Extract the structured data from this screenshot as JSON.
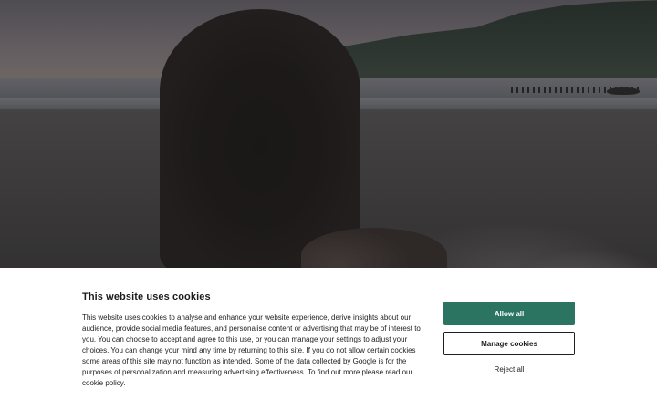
{
  "cookie_banner": {
    "title": "This website uses cookies",
    "body": "This website uses cookies to analyse and enhance your website experience, derive insights about our audience, provide social media features, and personalise content or advertising that may be of interest to you. You can choose to accept and agree to this use, or you can manage your settings to adjust your choices. You can change your mind any time by returning to this site. If you do not allow certain cookies some areas of this site may not function as intended. Some of the data collected by Google is for the purposes of personalization and measuring advertising effectiveness. To find out more please read our cookie policy.",
    "buttons": {
      "allow_all": "Allow all",
      "manage_cookies": "Manage cookies",
      "reject_all": "Reject all"
    }
  },
  "colors": {
    "accent": "#2b7461",
    "panel_bg": "#ffffff",
    "text": "#1c1c1c"
  }
}
